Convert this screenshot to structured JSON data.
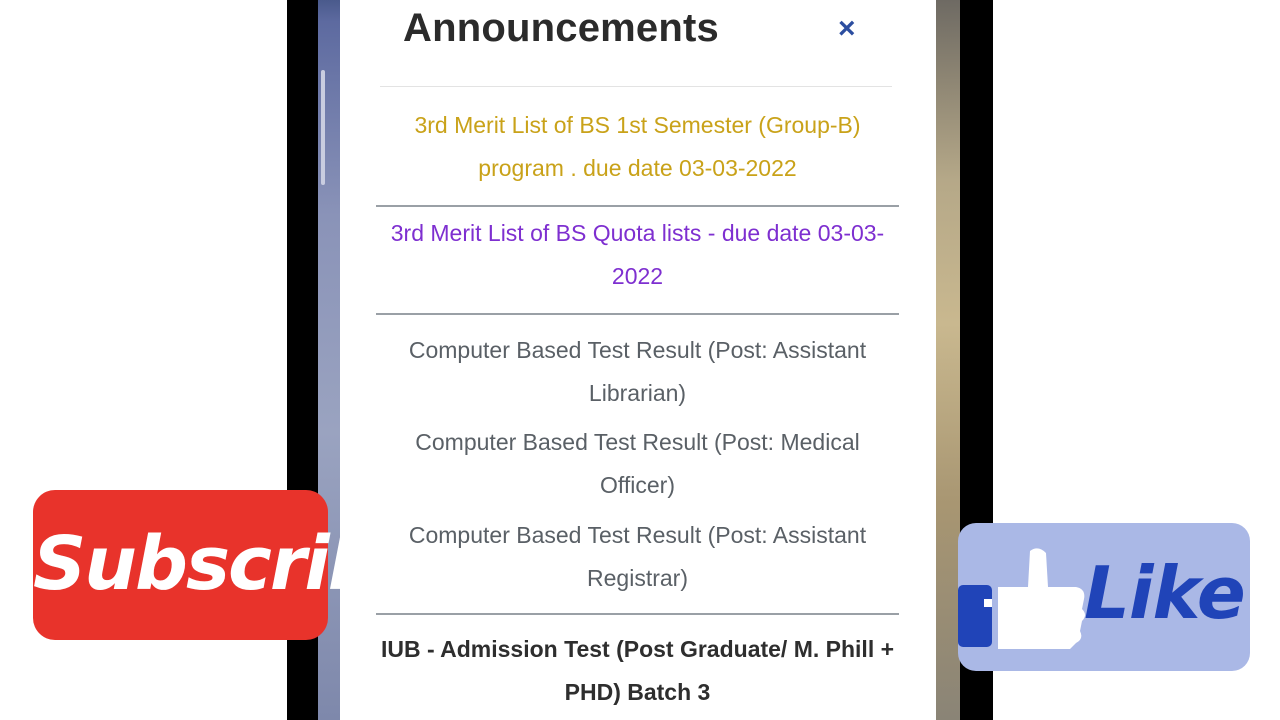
{
  "modal": {
    "title": "Announcements",
    "close_label": "×"
  },
  "announcements": [
    {
      "text": "3rd Merit List of BS 1st Semester (Group-B) program . due date 03-03-2022",
      "color": "#c9a219"
    },
    {
      "text": "3rd Merit List of BS Quota lists - due date 03-03-2022",
      "color": "#7e2fd0"
    },
    {
      "text": "Computer Based Test Result (Post: Assistant Librarian)",
      "color": "#5a6066"
    },
    {
      "text": "Computer Based Test Result (Post: Medical Officer)",
      "color": "#5a6066"
    },
    {
      "text": "Computer Based Test Result (Post: Assistant Registrar)",
      "color": "#5a6066"
    },
    {
      "text": "IUB - Admission Test (Post Graduate/ M. Phill + PHD) Batch 3",
      "color": "#2e2e2e"
    }
  ],
  "overlays": {
    "subscribe_label": "Subscribe",
    "subscribe_color": "#e8332b",
    "like_label": "Like",
    "like_icon": "thumbs-up-icon",
    "like_color": "#2044b8"
  }
}
